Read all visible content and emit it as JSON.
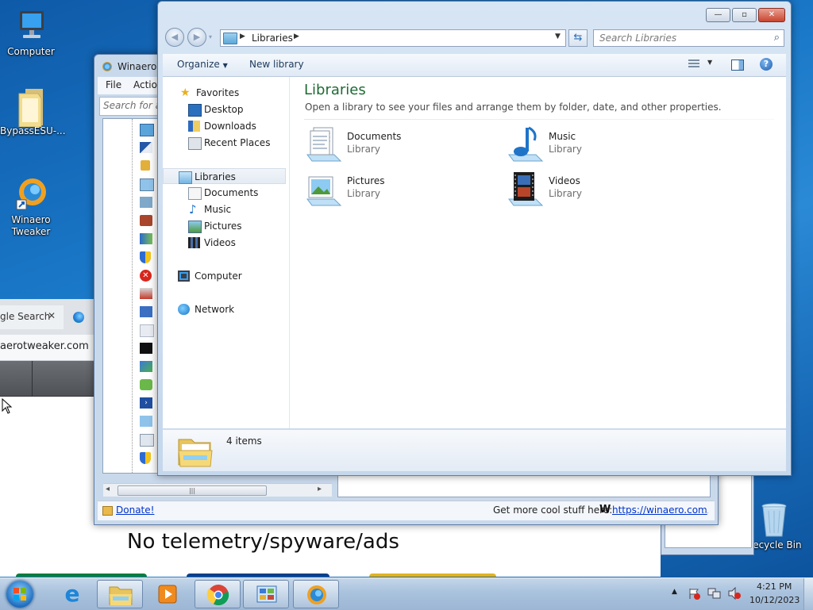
{
  "desktop": {
    "icons": [
      {
        "label": "Computer"
      },
      {
        "label": "BypassESU-..."
      },
      {
        "label": "Winaero Tweaker"
      },
      {
        "label": "Recycle Bin"
      }
    ]
  },
  "browser": {
    "tab_label": "gle Search",
    "tab_close": "✕",
    "address": "aerotweaker.com",
    "banner_text": "No telemetry/spyware/ads"
  },
  "winaero": {
    "title": "Winaero",
    "menu": [
      "File",
      "Actio"
    ],
    "search_placeholder": "Search for a",
    "scroll_mark": "|||",
    "donate_label": "Donate!",
    "footer_text": "Get more cool stuff here:",
    "footer_link": "https://winaero.com",
    "footer_w": "W"
  },
  "explorer": {
    "address": {
      "location": "Libraries"
    },
    "search_placeholder": "Search Libraries",
    "commands": {
      "organize": "Organize",
      "new_library": "New library"
    },
    "nav": {
      "favorites": "Favorites",
      "desktop": "Desktop",
      "downloads": "Downloads",
      "recent": "Recent Places",
      "libraries": "Libraries",
      "documents": "Documents",
      "music": "Music",
      "pictures": "Pictures",
      "videos": "Videos",
      "computer": "Computer",
      "network": "Network"
    },
    "content": {
      "heading": "Libraries",
      "subheading": "Open a library to see your files and arrange them by folder, date, and other properties.",
      "libraries": [
        {
          "name": "Documents",
          "type": "Library"
        },
        {
          "name": "Music",
          "type": "Library"
        },
        {
          "name": "Pictures",
          "type": "Library"
        },
        {
          "name": "Videos",
          "type": "Library"
        }
      ]
    },
    "status": {
      "items": "4 items"
    }
  },
  "taskbar": {
    "clock_time": "4:21 PM",
    "clock_date": "10/12/2023"
  }
}
